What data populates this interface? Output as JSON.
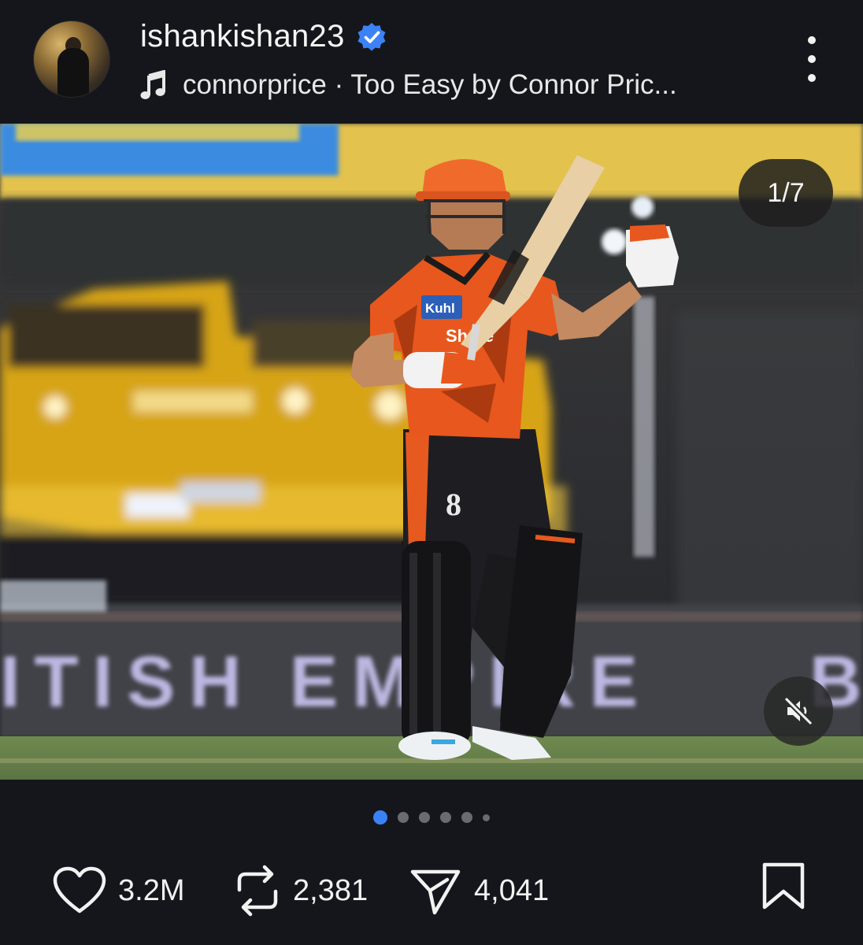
{
  "post": {
    "username": "ishankishan23",
    "verified": true,
    "audio": "connorprice · Too Easy by Connor Pric...",
    "icons": {
      "music": "music-note-icon",
      "more": "more-vertical-icon",
      "verified": "verified-badge-icon"
    }
  },
  "media": {
    "counter": "1/7",
    "mute_icon": "volume-muted-icon",
    "image_description": "cricket batter in orange jersey raising bat",
    "scene_text": {
      "jersey_sponsor_1": "Kuhl",
      "jersey_sponsor_2": "Shree",
      "jersey_number": "8",
      "board": "ITISH EMPIRE",
      "board_right": "B"
    }
  },
  "carousel": {
    "total": 7,
    "active_index": 0,
    "accent": "#3b82f6"
  },
  "actions": {
    "likes": "3.2M",
    "reposts": "2,381",
    "shares": "4,041",
    "icons": [
      "heart-icon",
      "repost-icon",
      "send-icon",
      "bookmark-icon"
    ]
  },
  "colors": {
    "background": "#15161b",
    "text": "#f2f2f2",
    "verified": "#3b82f6"
  }
}
